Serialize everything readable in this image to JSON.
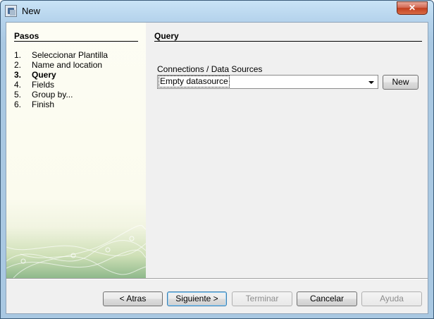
{
  "window": {
    "title": "New",
    "close_label": "✕"
  },
  "left_panel": {
    "title": "Pasos",
    "steps": [
      {
        "num": "1.",
        "label": "Seleccionar Plantilla",
        "active": false
      },
      {
        "num": "2.",
        "label": "Name and location",
        "active": false
      },
      {
        "num": "3.",
        "label": "Query",
        "active": true
      },
      {
        "num": "4.",
        "label": "Fields",
        "active": false
      },
      {
        "num": "5.",
        "label": "Group by...",
        "active": false
      },
      {
        "num": "6.",
        "label": "Finish",
        "active": false
      }
    ]
  },
  "main": {
    "title": "Query",
    "connections_label": "Connections / Data Sources",
    "datasource_value": "Empty datasource",
    "new_button_label": "New"
  },
  "footer": {
    "back_label": "< Atras",
    "next_label": "Siguiente >",
    "finish_label": "Terminar",
    "cancel_label": "Cancelar",
    "help_label": "Ayuda"
  }
}
